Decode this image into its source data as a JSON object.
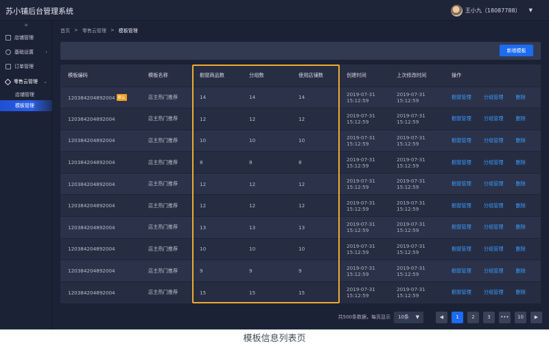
{
  "app": {
    "title": "苏小铺后台管理系统"
  },
  "user": {
    "name": "王小九（18087788）",
    "caret": "▼"
  },
  "sidebar": {
    "collapse": "≡",
    "items": [
      {
        "label": "店铺管理",
        "icon": "grid-icon"
      },
      {
        "label": "基础设置",
        "icon": "gear-icon",
        "arrow": "›"
      },
      {
        "label": "订单管理",
        "icon": "document-icon"
      },
      {
        "label": "零售云管理",
        "icon": "tag-icon",
        "arrow": "⌄"
      }
    ],
    "sub_items": [
      {
        "label": "店铺管理"
      },
      {
        "label": "模板管理",
        "selected": true
      }
    ]
  },
  "breadcrumb": {
    "items": [
      "首页",
      "零售云管理",
      "模板管理"
    ],
    "separator": ">"
  },
  "toolbar": {
    "add_label": "新增模板"
  },
  "table": {
    "columns": [
      "模板编码",
      "模板名称",
      "橱窗商品数",
      "分组数",
      "使用店铺数",
      "创建时间",
      "上次修改时间",
      "操作"
    ],
    "default_tag": "默认",
    "actions": [
      "橱窗管理",
      "分组管理",
      "删除"
    ],
    "rows": [
      {
        "code": "120384204892004",
        "name": "店主热门推荐",
        "window": "14",
        "groups": "14",
        "shops": "14",
        "created_date": "2019-07-31",
        "created_time": "15:12:59",
        "modified_date": "2019-07-31",
        "modified_time": "15:12:59"
      },
      {
        "code": "120384204892004",
        "name": "店主热门推荐",
        "window": "12",
        "groups": "12",
        "shops": "12",
        "created_date": "2019-07-31",
        "created_time": "15:12:59",
        "modified_date": "2019-07-31",
        "modified_time": "15:12:59"
      },
      {
        "code": "120384204892004",
        "name": "店主热门推荐",
        "window": "10",
        "groups": "10",
        "shops": "10",
        "created_date": "2019-07-31",
        "created_time": "15:12:59",
        "modified_date": "2019-07-31",
        "modified_time": "15:12:59"
      },
      {
        "code": "120384204892004",
        "name": "店主热门推荐",
        "window": "8",
        "groups": "8",
        "shops": "8",
        "created_date": "2019-07-31",
        "created_time": "15:12:59",
        "modified_date": "2019-07-31",
        "modified_time": "15:12:59"
      },
      {
        "code": "120384204892004",
        "name": "店主热门推荐",
        "window": "12",
        "groups": "12",
        "shops": "12",
        "created_date": "2019-07-31",
        "created_time": "15:12:59",
        "modified_date": "2019-07-31",
        "modified_time": "15:12:59"
      },
      {
        "code": "120384204892004",
        "name": "店主热门推荐",
        "window": "12",
        "groups": "12",
        "shops": "12",
        "created_date": "2019-07-31",
        "created_time": "15:12:59",
        "modified_date": "2019-07-31",
        "modified_time": "15:12:59"
      },
      {
        "code": "120384204892004",
        "name": "店主热门推荐",
        "window": "13",
        "groups": "13",
        "shops": "13",
        "created_date": "2019-07-31",
        "created_time": "15:12:59",
        "modified_date": "2019-07-31",
        "modified_time": "15:12:59"
      },
      {
        "code": "120384204892004",
        "name": "店主热门推荐",
        "window": "10",
        "groups": "10",
        "shops": "10",
        "created_date": "2019-07-31",
        "created_time": "15:12:59",
        "modified_date": "2019-07-31",
        "modified_time": "15:12:59"
      },
      {
        "code": "120384204892004",
        "name": "店主热门推荐",
        "window": "9",
        "groups": "9",
        "shops": "9",
        "created_date": "2019-07-31",
        "created_time": "15:12:59",
        "modified_date": "2019-07-31",
        "modified_time": "15:12:59"
      },
      {
        "code": "120384204892004",
        "name": "店主热门推荐",
        "window": "15",
        "groups": "15",
        "shops": "15",
        "created_date": "2019-07-31",
        "created_time": "15:12:59",
        "modified_date": "2019-07-31",
        "modified_time": "15:12:59"
      }
    ]
  },
  "pagination": {
    "info": "共500条数据，每页显示",
    "page_size": "10条",
    "size_caret": "▼",
    "prev": "◀",
    "pages": [
      "1",
      "2",
      "3"
    ],
    "ellipsis": "•••",
    "last": "10",
    "next": "▶",
    "current": "1"
  },
  "colors": {
    "accent": "#1c6bf0",
    "link": "#3a9bff",
    "highlight": "#f3ad2b",
    "tag": "#f0a020",
    "bg": "#1c2236"
  },
  "caption": "模板信息列表页"
}
